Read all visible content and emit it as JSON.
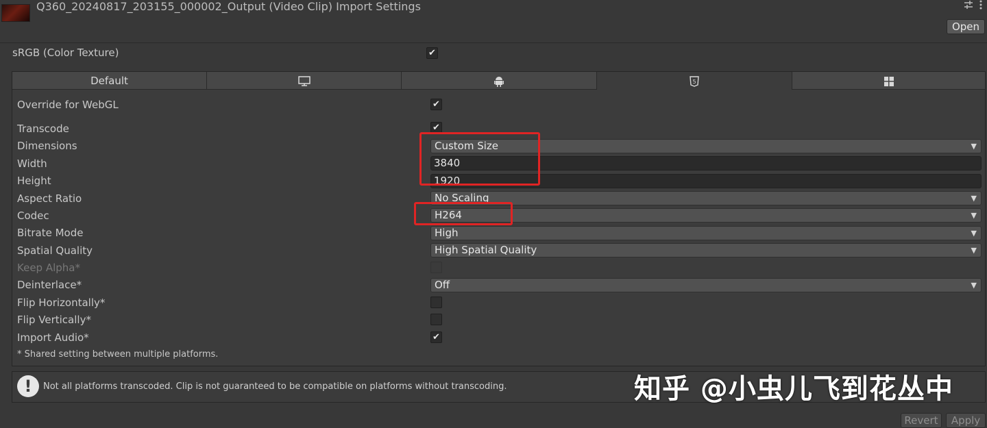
{
  "header": {
    "title": "Q360_20240817_203155_000002_Output (Video Clip) Import Settings",
    "thumbnail_icon": "video-thumbnail",
    "settings_icon": "sliders-icon",
    "menu_icon": "kebab-menu-icon",
    "open_label": "Open"
  },
  "srgb": {
    "label": "sRGB (Color Texture)",
    "checked": true
  },
  "tabs": [
    {
      "label": "Default",
      "icon": ""
    },
    {
      "label": "",
      "icon": "monitor-icon"
    },
    {
      "label": "",
      "icon": "android-icon"
    },
    {
      "label": "",
      "icon": "html5-icon",
      "selected": true
    },
    {
      "label": "",
      "icon": "windows-icon"
    }
  ],
  "settings": {
    "override": {
      "label": "Override for WebGL",
      "checked": true
    },
    "transcode": {
      "label": "Transcode",
      "checked": true
    },
    "dimensions": {
      "label": "Dimensions",
      "value": "Custom Size"
    },
    "width": {
      "label": "Width",
      "value": "3840"
    },
    "height": {
      "label": "Height",
      "value": "1920"
    },
    "aspect_ratio": {
      "label": "Aspect Ratio",
      "value": "No Scaling"
    },
    "codec": {
      "label": "Codec",
      "value": "H264"
    },
    "bitrate_mode": {
      "label": "Bitrate Mode",
      "value": "High"
    },
    "spatial_quality": {
      "label": "Spatial Quality",
      "value": "High Spatial Quality"
    },
    "keep_alpha": {
      "label": "Keep Alpha*",
      "checked": false,
      "disabled": true
    },
    "deinterlace": {
      "label": "Deinterlace*",
      "value": "Off"
    },
    "flip_h": {
      "label": "Flip Horizontally*",
      "checked": false
    },
    "flip_v": {
      "label": "Flip Vertically*",
      "checked": false
    },
    "import_audio": {
      "label": "Import Audio*",
      "checked": true
    },
    "shared_note": "* Shared setting between multiple platforms."
  },
  "warning": {
    "icon": "exclamation-icon",
    "text": "Not all platforms transcoded. Clip is not guaranteed to be compatible on platforms without transcoding."
  },
  "footer": {
    "revert_label": "Revert",
    "apply_label": "Apply"
  },
  "watermark": "知乎 @小虫儿飞到花丛中",
  "colors": {
    "highlight": "#e02424",
    "background": "#383838"
  }
}
